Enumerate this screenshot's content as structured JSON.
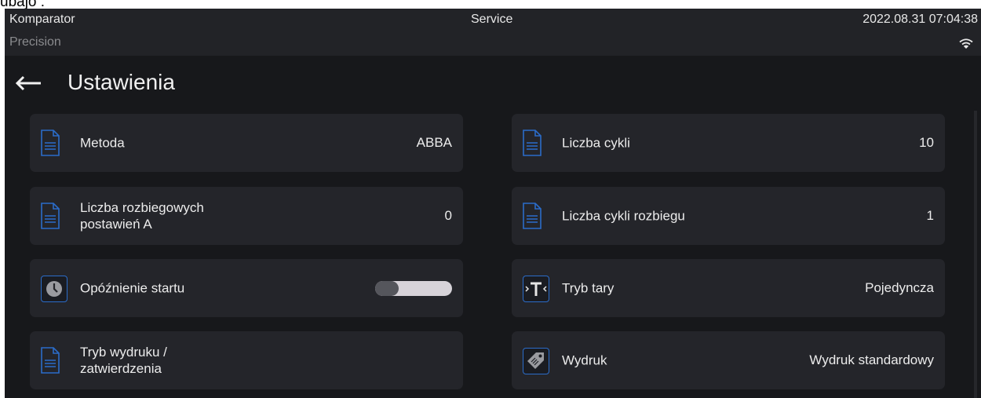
{
  "cropped_caption": "ubajo :",
  "status_bar": {
    "app_name": "Komparator",
    "mode": "Precision",
    "center_label": "Service",
    "datetime": "2022.08.31 07:04:38",
    "wifi_icon": "wifi-icon"
  },
  "header": {
    "back_icon": "arrow-left-icon",
    "title": "Ustawienia"
  },
  "settings": {
    "metoda": {
      "label": "Metoda",
      "value": "ABBA",
      "icon": "document-icon"
    },
    "liczba_cykli": {
      "label": "Liczba cykli",
      "value": "10",
      "icon": "document-icon"
    },
    "liczba_rozbiegowych": {
      "label": "Liczba rozbiegowych postawień A",
      "value": "0",
      "icon": "document-icon"
    },
    "liczba_cykli_rozbiegu": {
      "label": "Liczba cykli rozbiegu",
      "value": "1",
      "icon": "document-icon"
    },
    "opoznienie_startu": {
      "label": "Opóźnienie startu",
      "toggle_state": "off",
      "icon": "clock-icon"
    },
    "tryb_tary": {
      "label": "Tryb tary",
      "value": "Pojedyncza",
      "icon": "tare-icon"
    },
    "tryb_wydruku": {
      "label": "Tryb wydruku / zatwierdzenia",
      "value": "",
      "icon": "document-icon"
    },
    "wydruk": {
      "label": "Wydruk",
      "value": "Wydruk standardowy",
      "icon": "tag-icon"
    }
  },
  "colors": {
    "background": "#17181b",
    "card": "#24252a",
    "accent": "#2b6cc9",
    "text": "#ececec"
  }
}
